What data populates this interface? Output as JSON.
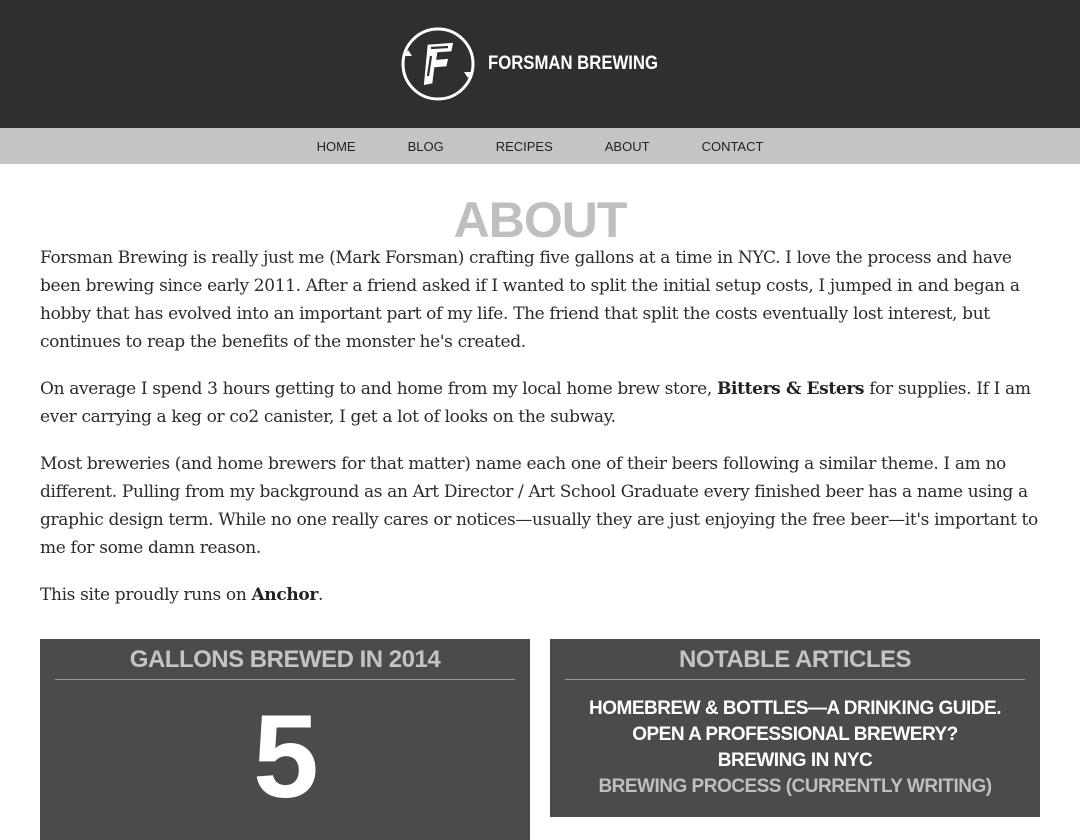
{
  "header": {
    "brand_name": "FORSMAN BREWING",
    "logo_icon": "forsman-f-logo-icon"
  },
  "nav": {
    "items": [
      {
        "label": "HOME"
      },
      {
        "label": "BLOG"
      },
      {
        "label": "RECIPES"
      },
      {
        "label": "ABOUT"
      },
      {
        "label": "CONTACT"
      }
    ]
  },
  "page": {
    "title": "ABOUT",
    "paragraphs": [
      {
        "text": "Forsman Brewing is really just me (Mark Forsman) crafting five gallons at a time in NYC. I love the process and have been brewing since early 2011. After a friend asked if I wanted to split the initial setup costs, I jumped in and began a hobby that has evolved into an important part of my life. The friend that split the costs eventually lost interest, but continues to reap the benefits of the monster he's created."
      },
      {
        "before": "On average I spend 3 hours getting to and home from my local home brew store, ",
        "link": "Bitters & Esters",
        "after": " for supplies. If I am ever carrying a keg or co2 canister, I get a lot of looks on the subway."
      },
      {
        "text": "Most breweries (and home brewers for that matter) name each one of their beers following a similar theme. I am no different. Pulling from my background as an Art Director / Art School Graduate every finished beer has a name using a graphic design term. While no one really cares or notices—usually they are just enjoying the free beer—it's important to me for some damn reason."
      },
      {
        "before": "This site proudly runs on ",
        "link": "Anchor",
        "after": "."
      }
    ]
  },
  "gallons_panel": {
    "title": "GALLONS BREWED IN 2014",
    "value": "5"
  },
  "articles_panel": {
    "title": "NOTABLE ARTICLES",
    "items": [
      {
        "label": "HOMEBREW & BOTTLES—A DRINKING GUIDE."
      },
      {
        "label": "OPEN A PROFESSIONAL BREWERY?"
      },
      {
        "label": "BREWING IN NYC"
      },
      {
        "label": "BREWING PROCESS (CURRENTLY WRITING)"
      }
    ]
  },
  "colors": {
    "header_bg": "#2f2f2f",
    "nav_bg": "#c4c4c4",
    "panel_bg": "#4b4b4b",
    "title_gray": "#bfbfbf"
  }
}
